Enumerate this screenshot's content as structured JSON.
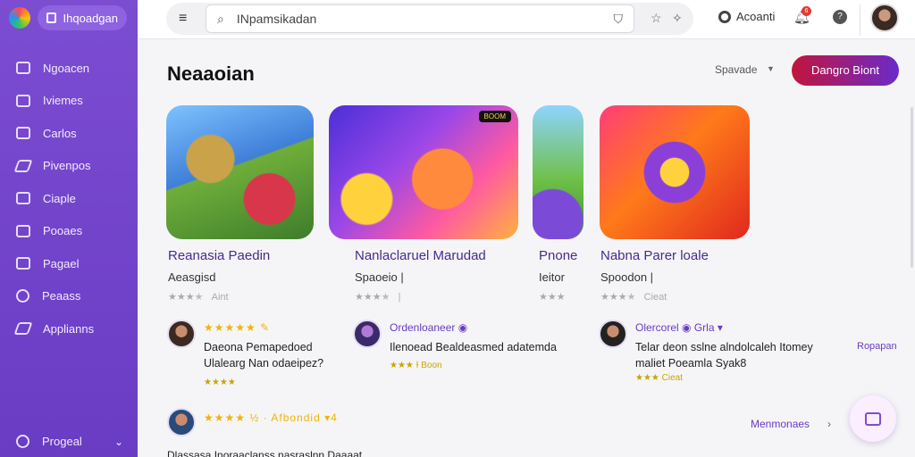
{
  "brand": {
    "name": "Ihqoadgan"
  },
  "sidebar": {
    "items": [
      {
        "label": "Ngoacen",
        "icon": "grid-icon"
      },
      {
        "label": "Iviemes",
        "icon": "game-icon"
      },
      {
        "label": "Carlos",
        "icon": "book-icon"
      },
      {
        "label": "Pivenpos",
        "icon": "pen-icon"
      },
      {
        "label": "Ciaple",
        "icon": "window-icon"
      },
      {
        "label": "Pooaes",
        "icon": "folder-icon"
      },
      {
        "label": "Pagael",
        "icon": "page-icon"
      },
      {
        "label": "Peaass",
        "icon": "circle-icon"
      },
      {
        "label": "Applianns",
        "icon": "wrench-icon"
      }
    ],
    "footer": {
      "label": "Progeal"
    }
  },
  "topbar": {
    "search_placeholder": "INpamsikadan",
    "account_label": "Acoanti",
    "notification_count": "6"
  },
  "main": {
    "title": "Neaaoian",
    "sort_label": "Spavade",
    "cta_label": "Dangro Biont",
    "cards": [
      {
        "title": "Reanasia Paedin",
        "subtitle": "Aeasgisd",
        "rating_text": "Aint"
      },
      {
        "title": "Nanlaclaruel Marudad",
        "subtitle": "Spaoeio |",
        "rating_text": "|"
      },
      {
        "title": "Pnone",
        "subtitle": "Ieitor",
        "rating_text": ""
      },
      {
        "title": "Nabna Parer loale",
        "subtitle": "Spoodon |",
        "rating_text": "Cieat"
      }
    ],
    "tile_badge": "BOOM",
    "reviews": [
      {
        "header": "★★★★★ ✎",
        "text_line1": "Daeona Pemapedoed",
        "text_line2": "Ulalearg Nan odaeipez?",
        "mini": "★★★★"
      },
      {
        "header": "Ordenloaneer ◉",
        "text_line1": "Ilenoead Bealdeasmed adatemda",
        "text_line2": "",
        "mini": "★★★ Ɨ Boon"
      },
      {
        "header": "Olercorel ◉ Grla ▾",
        "text_line1": "Telar deon sslne alndolcaleh Itomey",
        "text_line2": "maliet Poeamla Syak8",
        "mini": "★★★ Cieat"
      },
      {
        "header": "★★★★ ½ · Afbondid ▾4",
        "text_line1": "",
        "text_line2": "",
        "mini": ""
      }
    ],
    "review_link": "Ropapan",
    "more_link": "Menmonaes",
    "bottom_text": "Dlassasa Inoraaclanss nasraslnn Daaaat"
  },
  "colors": {
    "accent": "#7c4dd1",
    "cta_start": "#c2143c",
    "cta_end": "#6a2bc9"
  }
}
